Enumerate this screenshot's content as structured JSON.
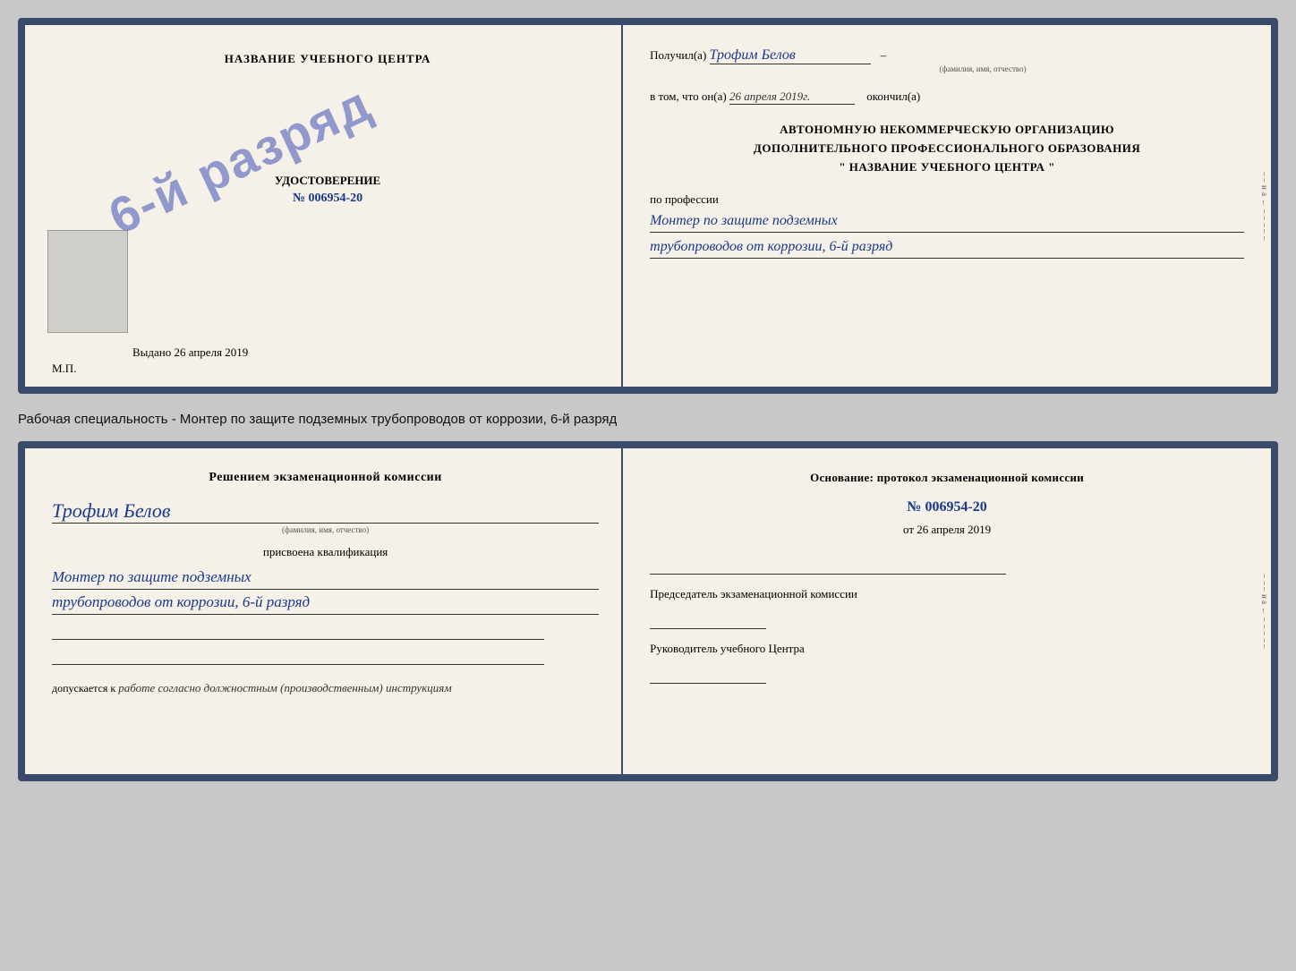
{
  "page": {
    "background_color": "#c8c8c8"
  },
  "top_cert": {
    "left": {
      "title": "НАЗВАНИЕ УЧЕБНОГО ЦЕНТРА",
      "stamp_text": "6-й разряд",
      "udostoverenie_label": "УДОСТОВЕРЕНИЕ",
      "number": "№ 006954-20",
      "vydano_label": "Выдано",
      "vydano_date": "26 апреля 2019",
      "mp_label": "М.П."
    },
    "right": {
      "poluchil_label": "Получил(а)",
      "person_name": "Трофим Белов",
      "fio_hint": "(фамилия, имя, отчество)",
      "vtom_label": "в том, что он(а)",
      "date_value": "26 апреля 2019г.",
      "okonchil_label": "окончил(а)",
      "org_line1": "АВТОНОМНУЮ НЕКОММЕРЧЕСКУЮ ОРГАНИЗАЦИЮ",
      "org_line2": "ДОПОЛНИТЕЛЬНОГО ПРОФЕССИОНАЛЬНОГО ОБРАЗОВАНИЯ",
      "org_quote1": "\"",
      "org_name": "НАЗВАНИЕ УЧЕБНОГО ЦЕНТРА",
      "org_quote2": "\"",
      "po_professii_label": "по профессии",
      "profession_line1": "Монтер по защите подземных",
      "profession_line2": "трубопроводов от коррозии, 6-й разряд",
      "side_chars": [
        "–",
        "–",
        "и",
        "а",
        "←",
        "–",
        "–",
        "–",
        "–",
        "–"
      ]
    }
  },
  "specialty_label": "Рабочая специальность - Монтер по защите подземных трубопроводов от коррозии, 6-й разряд",
  "bottom_cert": {
    "left": {
      "resheniem_label": "Решением экзаменационной комиссии",
      "person_name": "Трофим Белов",
      "fio_hint": "(фамилия, имя, отчество)",
      "prisvoena_label": "присвоена квалификация",
      "qual_line1": "Монтер по защите подземных",
      "qual_line2": "трубопроводов от коррозии, 6-й разряд",
      "dopusk_label": "допускается к",
      "dopusk_text": "работе согласно должностным (производственным) инструкциям"
    },
    "right": {
      "osnovanie_label": "Основание: протокол экзаменационной комиссии",
      "number": "№ 006954-20",
      "ot_label": "от",
      "ot_date": "26 апреля 2019",
      "predsedatel_label": "Председатель экзаменационной комиссии",
      "rukovoditel_label": "Руководитель учебного Центра",
      "side_chars": [
        "–",
        "–",
        "–",
        "и",
        "а",
        "←",
        "–",
        "–",
        "–",
        "–",
        "–"
      ]
    }
  }
}
